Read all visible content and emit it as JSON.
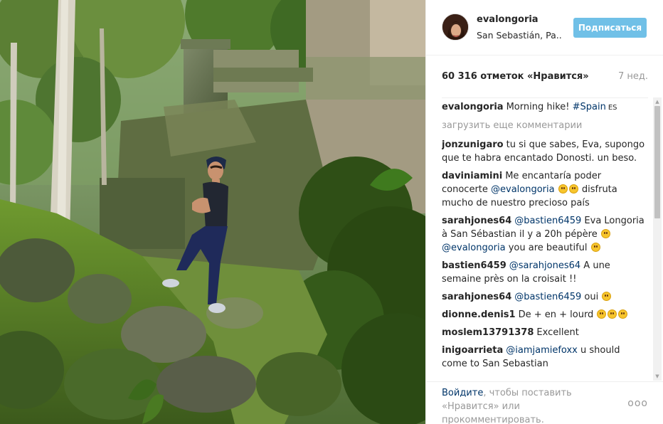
{
  "post": {
    "username": "evalongoria",
    "location": "San Sebastián, Pa...",
    "follow_label": "Подписаться",
    "likes": "60 316 отметок «Нравится»",
    "age": "7 нед.",
    "caption": {
      "user": "evalongoria",
      "text": "Morning hike! ",
      "hashtag": "#Spain",
      "flag": "ES"
    },
    "load_more": "загрузить еще комментарии"
  },
  "comments": [
    {
      "user": "jonzunigaro",
      "text": "tu si que sabes, Eva, supongo que te habra encantado Donosti. un beso."
    },
    {
      "user": "daviniamini",
      "text1": "Me encantaría poder conocerte ",
      "mention": "@evalongoria",
      "text2": " disfruta mucho de nuestro precioso país"
    },
    {
      "user": "sarahjones64",
      "mention1": "@bastien6459",
      "text1": " Eva Longoria à San Sébastian il y a 20h pépère ",
      "mention2": "@evalongoria",
      "text2": " you are beautiful "
    },
    {
      "user": "bastien6459",
      "mention": "@sarahjones64",
      "text": " A une semaine près on la croisait !!"
    },
    {
      "user": "sarahjones64",
      "mention": "@bastien6459",
      "text": " oui "
    },
    {
      "user": "dionne.denis1",
      "text": "De + en + lourd "
    },
    {
      "user": "moslem13791378",
      "text": "Excellent"
    },
    {
      "user": "inigoarrieta",
      "mention": "@iamjamiefoxx",
      "text": " u should come to San Sebastian"
    }
  ],
  "footer": {
    "login": "Войдите",
    "text": ", чтобы поставить «Нравится» или прокомментировать.",
    "more": "ooo"
  },
  "icons": {
    "scroll_up": "scroll-up-arrow-icon",
    "scroll_down": "scroll-down-arrow-icon",
    "more": "more-options-icon"
  },
  "colors": {
    "follow_button": "#70c0e7",
    "mention": "#003569",
    "muted": "#999999"
  }
}
